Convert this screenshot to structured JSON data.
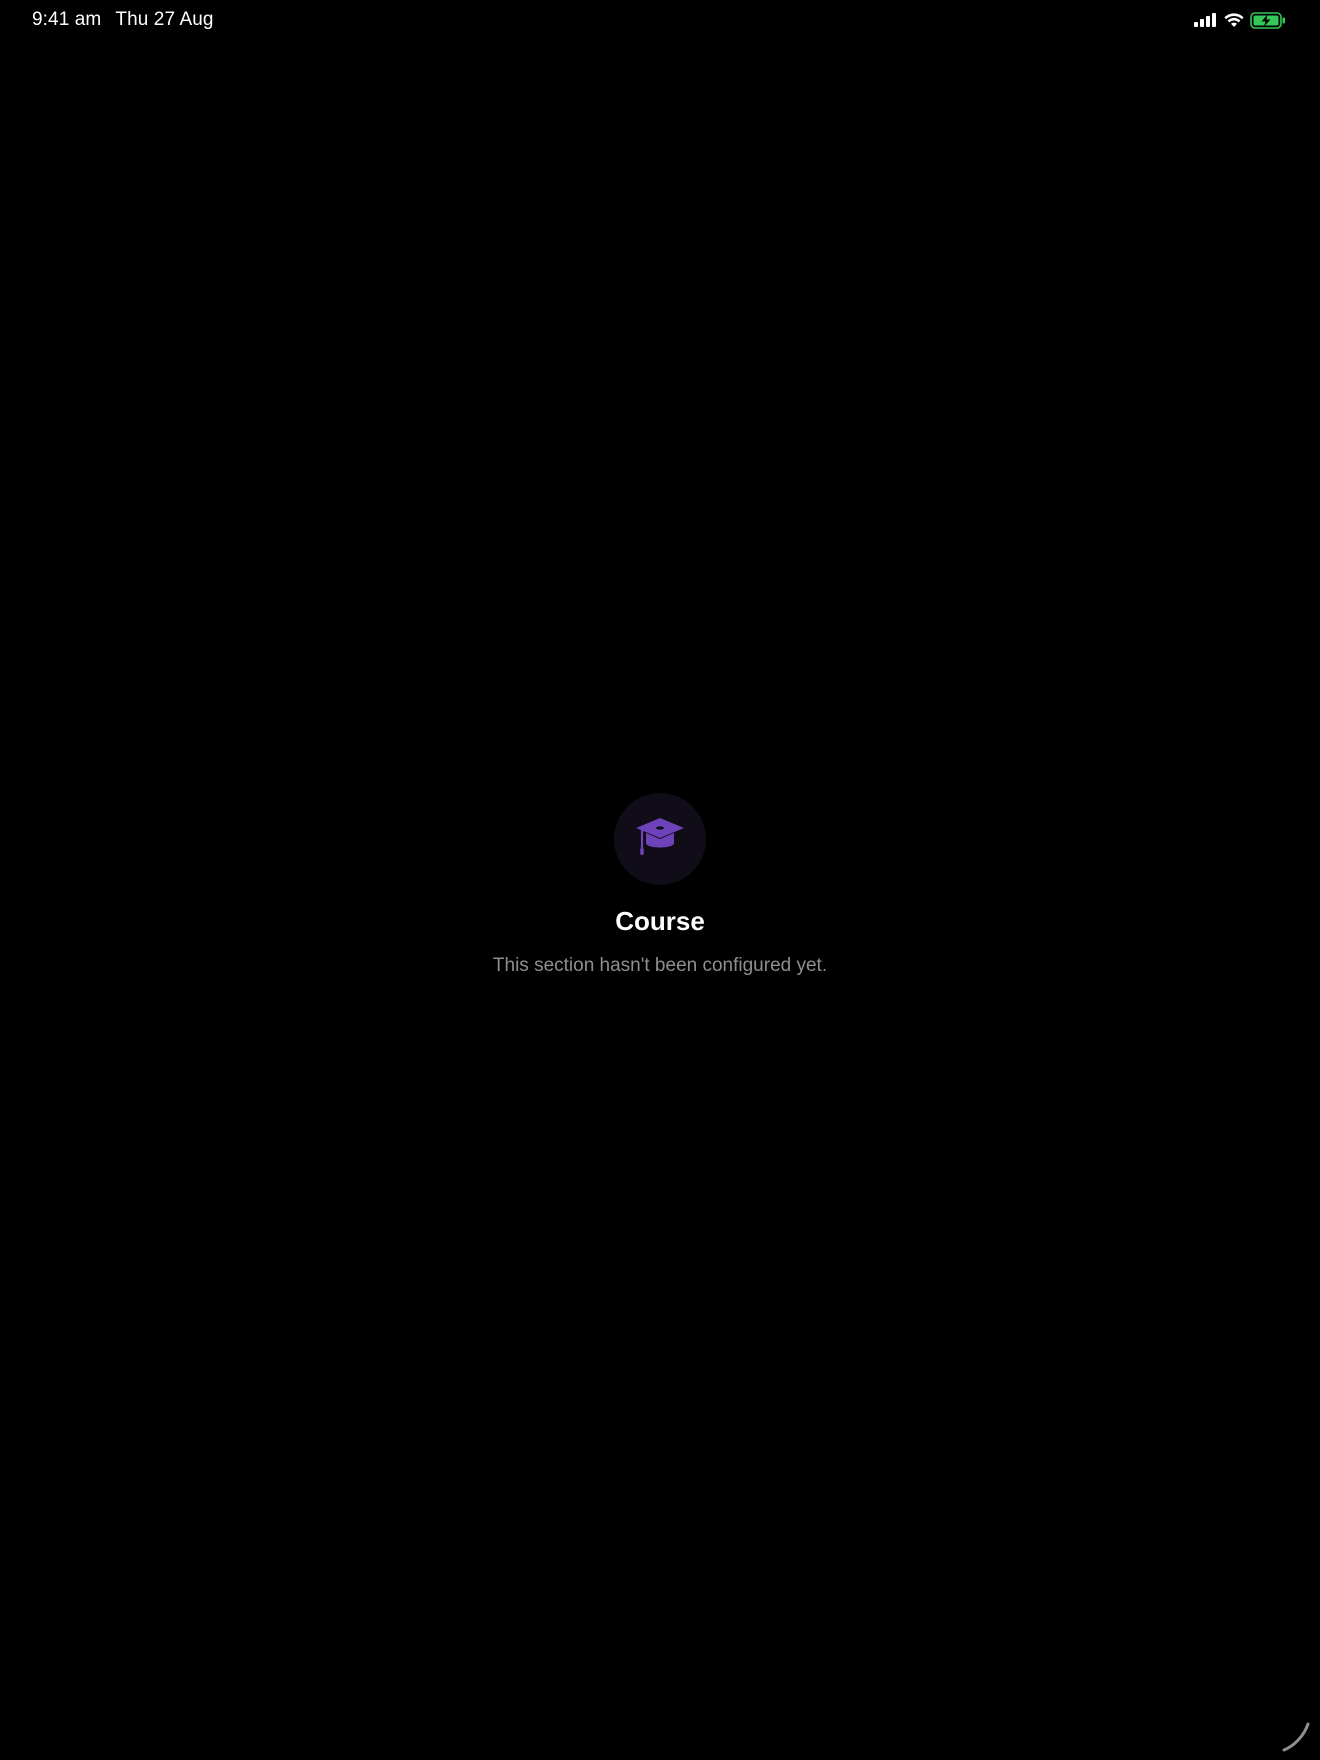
{
  "status_bar": {
    "time": "9:41 am",
    "date": "Thu 27 Aug",
    "icons": [
      "cellular-signal-icon",
      "wifi-icon",
      "battery-charging-icon"
    ],
    "battery_color": "#34c759"
  },
  "empty_state": {
    "icon": "graduation-cap-icon",
    "icon_color": "#6e42b8",
    "icon_bg_color": "#100d19",
    "title": "Course",
    "message": "This section hasn't been configured yet."
  },
  "indicator": {
    "icon": "loading-spinner-icon"
  }
}
